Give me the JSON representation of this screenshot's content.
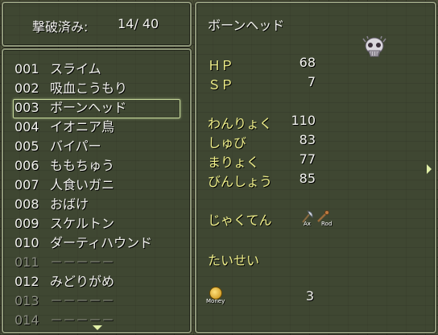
{
  "counter": {
    "label": "撃破済み:",
    "value": "14/ 40"
  },
  "bestiary": {
    "entries": [
      {
        "num": "001",
        "name": "スライム",
        "known": true
      },
      {
        "num": "002",
        "name": "吸血こうもり",
        "known": true
      },
      {
        "num": "003",
        "name": "ボーンヘッド",
        "known": true
      },
      {
        "num": "004",
        "name": "イオニア鳥",
        "known": true
      },
      {
        "num": "005",
        "name": "バイパー",
        "known": true
      },
      {
        "num": "006",
        "name": "ももちゅう",
        "known": true
      },
      {
        "num": "007",
        "name": "人食いガニ",
        "known": true
      },
      {
        "num": "008",
        "name": "おばけ",
        "known": true
      },
      {
        "num": "009",
        "name": "スケルトン",
        "known": true
      },
      {
        "num": "010",
        "name": "ダーティハウンド",
        "known": true
      },
      {
        "num": "011",
        "name": "－－－－－",
        "known": false
      },
      {
        "num": "012",
        "name": "みどりがめ",
        "known": true
      },
      {
        "num": "013",
        "name": "－－－－－",
        "known": false
      },
      {
        "num": "014",
        "name": "－－－－－",
        "known": false
      }
    ],
    "selected_index": 2
  },
  "detail": {
    "name": "ボーンヘッド",
    "hp_label": "ＨＰ",
    "hp": "68",
    "sp_label": "ＳＰ",
    "sp": "7",
    "atk_label": "わんりょく",
    "atk": "110",
    "def_label": "しゅび",
    "def": "83",
    "mag_label": "まりょく",
    "mag": "77",
    "agi_label": "びんしょう",
    "agi": "85",
    "weak_label": "じゃくてん",
    "weak_icons": [
      {
        "icon": "axe-icon",
        "caption": "Ax"
      },
      {
        "icon": "rod-icon",
        "caption": "Rod"
      }
    ],
    "resist_label": "たいせい",
    "money_caption": "Money",
    "money": "3"
  },
  "colors": {
    "system_text": "#f0f08a",
    "normal_text": "#f2f2ee",
    "disabled_text": "#8c8f82"
  }
}
